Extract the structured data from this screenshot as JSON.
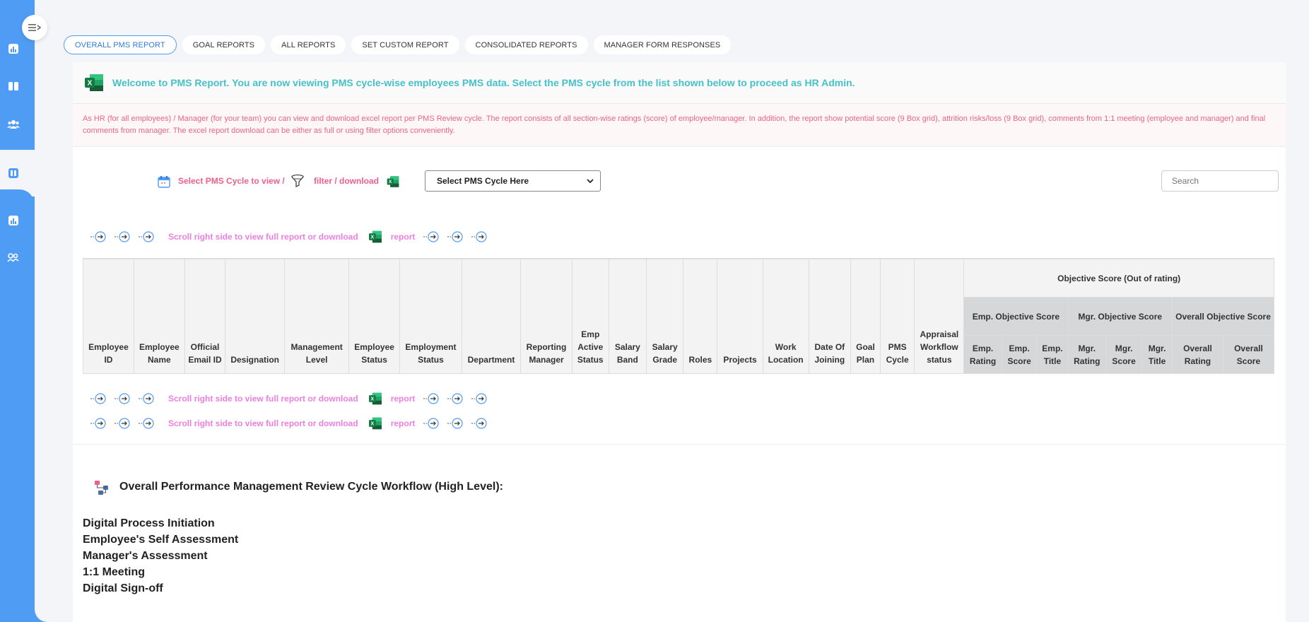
{
  "tabs": [
    {
      "label": "OVERALL PMS REPORT"
    },
    {
      "label": "GOAL REPORTS"
    },
    {
      "label": "ALL REPORTS"
    },
    {
      "label": "SET CUSTOM REPORT"
    },
    {
      "label": "CONSOLIDATED REPORTS"
    },
    {
      "label": "MANAGER FORM RESPONSES"
    }
  ],
  "welcome": {
    "text": "Welcome to PMS Report. You are now viewing PMS cycle-wise employees PMS data. Select the PMS cycle from the list shown below to proceed as HR Admin."
  },
  "description": "As HR (for all employees) / Manager (for your team) you can view and download excel report per PMS Review cycle. The report consists of all section-wise ratings (score) of employee/manager. In addition, the report show potential score (9 Box grid), attrition risks/loss (9 Box grid), comments from 1:1 meeting (employee and manager) and final comments from manager. The excel report download can be either as full or using filter options conveniently.",
  "selector": {
    "label1": "Select PMS Cycle to view /",
    "label2": "filter / download",
    "select_value": "Select PMS Cycle Here",
    "search_placeholder": "Search"
  },
  "scroll_hint": {
    "text": "Scroll right side to view full report or download",
    "report": "report"
  },
  "table": {
    "columns": [
      "Employee ID",
      "Employee Name",
      "Official Email ID",
      "Designation",
      "Management Level",
      "Employee Status",
      "Employment Status",
      "Department",
      "Reporting Manager",
      "Emp Active Status",
      "Salary Band",
      "Salary Grade",
      "Roles",
      "Projects",
      "Work Location",
      "Date Of Joining",
      "Goal Plan",
      "PMS Cycle",
      "Appraisal Workflow status"
    ],
    "group_header": "Objective Score (Out of rating)",
    "sub_groups": [
      "Emp. Objective Score",
      "Mgr. Objective Score",
      "Overall Objective Score"
    ],
    "leaf_headers": [
      "Emp. Rating",
      "Emp. Score",
      "Emp. Title",
      "Mgr. Rating",
      "Mgr. Score",
      "Mgr. Title",
      "Overall Rating",
      "Overall Score"
    ]
  },
  "workflow": {
    "title": "Overall Performance Management Review Cycle Workflow (High Level):",
    "steps": [
      "Digital Process Initiation",
      "Employee's Self Assessment",
      "Manager's Assessment",
      "1:1 Meeting",
      "Digital Sign-off"
    ]
  },
  "colors": {
    "sidebar": "#4f9cf5",
    "welcome": "#45c1c7",
    "desc": "#ec6487",
    "scroll": "#ee7fe0"
  }
}
